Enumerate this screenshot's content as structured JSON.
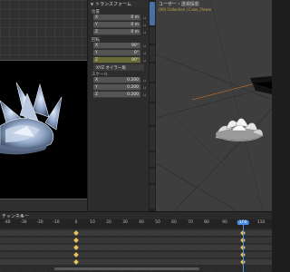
{
  "npanel": {
    "section_title": "トランスフォーム",
    "location_label": "位置",
    "location": [
      {
        "axis": "X",
        "value": "0 m"
      },
      {
        "axis": "Y",
        "value": "0 m"
      },
      {
        "axis": "Z",
        "value": "0 m"
      }
    ],
    "rotation_label": "回転",
    "rotation": [
      {
        "axis": "X",
        "value": "90°"
      },
      {
        "axis": "Y",
        "value": "0°"
      },
      {
        "axis": "Z",
        "value": "90°"
      }
    ],
    "rotation_mode": "XYZ オイラー角",
    "scale_label": "スケール",
    "scale": [
      {
        "axis": "X",
        "value": "0.200"
      },
      {
        "axis": "Y",
        "value": "0.200"
      },
      {
        "axis": "Z",
        "value": "0.200"
      }
    ]
  },
  "viewport_right": {
    "header_text": "ユーザー・透視投影",
    "sub_text": "(90) Collection | Cube_Flower"
  },
  "timeline": {
    "header_items": [
      "チャンネル",
      "キー"
    ],
    "ticks": [
      "-40",
      "-30",
      "-20",
      "-10",
      "0",
      "10",
      "20",
      "30",
      "40",
      "50",
      "60",
      "70",
      "80",
      "90",
      "100",
      "110"
    ],
    "current_frame": "100"
  },
  "colors": {
    "accent": "#4a8ee8",
    "keyframe": "#e8c65a",
    "selected_field": "#6a6a36",
    "active_tab": "#4a6fa5"
  }
}
